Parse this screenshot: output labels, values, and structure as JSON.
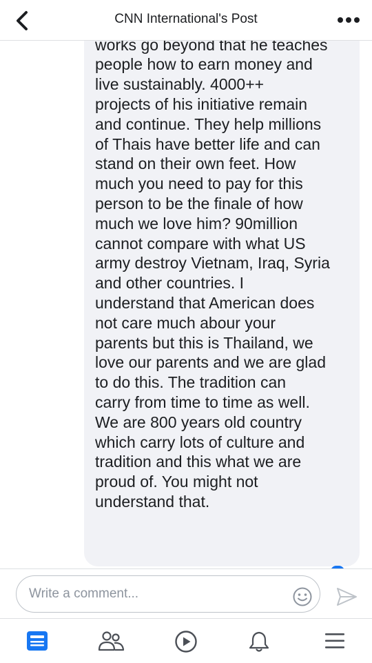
{
  "header": {
    "title": "CNN International's Post",
    "back_icon": "chevron-left-icon",
    "more_icon": "more-dots-icon"
  },
  "comment": {
    "text": "many people in a year? And\nafterter that, no food again.  His\nworks go beyond that he teaches\npeople how to earn money and\nlive sustainably.  4000++\nprojects of his initiative remain\nand continue.  They help millions\nof Thais have better life and can\nstand on their own feet. How\nmuch you need to pay for this\nperson to be the finale of how\nmuch we love him?   90million\ncannot compare with what US\narmy destroy Vietnam, Iraq, Syria\nand other countries.  I\nunderstand that American does\nnot care much abour your\nparents but this is Thailand, we\nlove our parents and we are glad\nto do this.   The tradition can\ncarry from time to time as well.\nWe are 800 years old country\nwhich carry lots of culture and\ntradition and this what we are\nproud of.  You might not\nunderstand that."
  },
  "composer": {
    "placeholder": "Write a comment...",
    "emoji_icon": "emoji-smile-icon",
    "send_icon": "send-icon"
  },
  "tabbar": {
    "items": [
      {
        "icon": "news-feed-icon",
        "active": true
      },
      {
        "icon": "friends-icon",
        "active": false
      },
      {
        "icon": "watch-play-icon",
        "active": false
      },
      {
        "icon": "notifications-bell-icon",
        "active": false
      },
      {
        "icon": "menu-hamburger-icon",
        "active": false
      }
    ]
  },
  "colors": {
    "accent": "#1877f2",
    "icon_gray": "#4b4f56",
    "bubble_bg": "#f1f2f6",
    "divider": "#dddfe2"
  }
}
